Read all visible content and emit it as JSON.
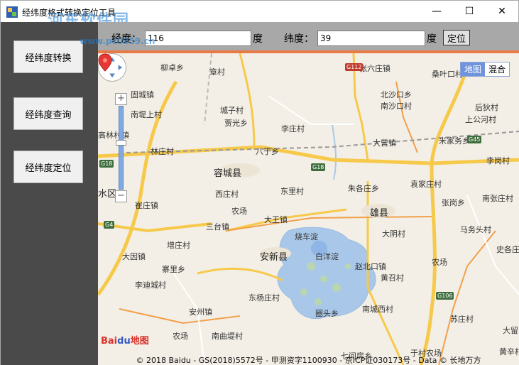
{
  "window": {
    "title": "经纬度格式转换定位工具",
    "watermark": "河东软件园",
    "watermark_url": "www.pc0359.cn",
    "minimize": "—",
    "maximize": "☐",
    "close": "✕"
  },
  "sidebar": {
    "items": [
      {
        "label": "经纬度转换"
      },
      {
        "label": "经纬度查询"
      },
      {
        "label": "经纬度定位"
      }
    ]
  },
  "toolbar": {
    "lng_label": "经度：",
    "lng_value": "116",
    "lng_unit": "度",
    "lat_label": "纬度：",
    "lat_value": "39",
    "lat_unit": "度",
    "locate_label": "定位"
  },
  "map": {
    "type_map": "地图",
    "type_hybrid": "混合",
    "zoom_in": "+",
    "zoom_out": "−",
    "copyright": "© 2018 Baidu - GS(2018)5572号 - 甲测资字1100930 - 京ICP证030173号 - Data © 长地万方",
    "logo": "Bai",
    "logo_paw": "du",
    "logo_suffix": "地图",
    "places": [
      {
        "name": "柳卓乡"
      },
      {
        "name": "章村"
      },
      {
        "name": "张六庄镇"
      },
      {
        "name": "桑叶口村"
      },
      {
        "name": "固城镇"
      },
      {
        "name": "北沙口乡"
      },
      {
        "name": "南沙口村"
      },
      {
        "name": "后狄村"
      },
      {
        "name": "南堤上村"
      },
      {
        "name": "城子村"
      },
      {
        "name": "贾光乡"
      },
      {
        "name": "上公河村"
      },
      {
        "name": "高林村镇"
      },
      {
        "name": "李庄村"
      },
      {
        "name": "米家务乡"
      },
      {
        "name": "林庄村"
      },
      {
        "name": "八于乡"
      },
      {
        "name": "大营镇"
      },
      {
        "name": "李岗村"
      },
      {
        "name": "容城县"
      },
      {
        "name": "水区"
      },
      {
        "name": "东里村"
      },
      {
        "name": "朱各庄乡"
      },
      {
        "name": "袁家庄村"
      },
      {
        "name": "西庄村"
      },
      {
        "name": "南张庄村"
      },
      {
        "name": "崔庄镇"
      },
      {
        "name": "农场"
      },
      {
        "name": "雄县"
      },
      {
        "name": "张岗乡"
      },
      {
        "name": "大王镇"
      },
      {
        "name": "三台镇"
      },
      {
        "name": "烧车淀"
      },
      {
        "name": "马务头村"
      },
      {
        "name": "大阴村"
      },
      {
        "name": "增庄村"
      },
      {
        "name": "白洋淀"
      },
      {
        "name": "史各庄"
      },
      {
        "name": "大因镇"
      },
      {
        "name": "安新县"
      },
      {
        "name": "赵北口镇"
      },
      {
        "name": "农场"
      },
      {
        "name": "寨里乡"
      },
      {
        "name": "黄召村"
      },
      {
        "name": "李迪城村"
      },
      {
        "name": "东杨庄村"
      },
      {
        "name": "安州镇"
      },
      {
        "name": "圈头乡"
      },
      {
        "name": "南城西村"
      },
      {
        "name": "苏庄村"
      },
      {
        "name": "农场"
      },
      {
        "name": "南曲堤村"
      },
      {
        "name": "七间房乡"
      },
      {
        "name": "于村农场"
      },
      {
        "name": "黄辛村"
      },
      {
        "name": "大留"
      }
    ],
    "shields": [
      {
        "name": "G112"
      },
      {
        "name": "G45"
      },
      {
        "name": "G18"
      },
      {
        "name": "G18"
      },
      {
        "name": "G4"
      },
      {
        "name": "G106"
      }
    ]
  }
}
